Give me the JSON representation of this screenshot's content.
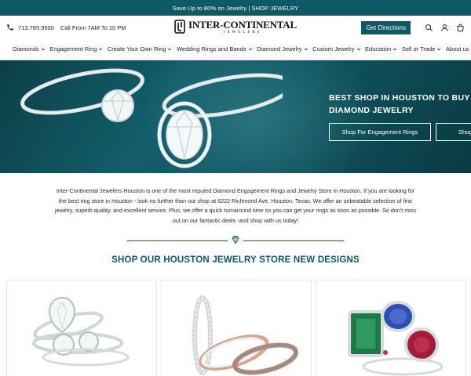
{
  "announcement": "Save Up to 80% on Jewelry | SHOP JEWELRY",
  "header": {
    "phone": "713.785.9500",
    "hours": "Call From 7AM To 10 PM",
    "logo_name": "INTER-CONTINENTAL",
    "logo_sub": "JEWELERS",
    "directions_label": "Get Directions",
    "icons": [
      "search-icon",
      "user-icon",
      "bag-icon"
    ]
  },
  "nav": [
    {
      "label": "Diamonds",
      "dropdown": true
    },
    {
      "label": "Engagement Ring",
      "dropdown": true
    },
    {
      "label": "Create Your Own Ring",
      "dropdown": true
    },
    {
      "label": "Wedding Rings and Bands",
      "dropdown": true
    },
    {
      "label": "Diamond Jewelry",
      "dropdown": true
    },
    {
      "label": "Custom Jewelry",
      "dropdown": true
    },
    {
      "label": "Education",
      "dropdown": true
    },
    {
      "label": "Sell or Trade",
      "dropdown": true
    },
    {
      "label": "About us",
      "dropdown": false
    }
  ],
  "hero": {
    "title_line1": "BEST SHOP IN HOUSTON TO BUY",
    "title_line2": "DIAMOND JEWELRY",
    "button_primary": "Shop For Engagement Rings",
    "button_secondary": "Shop"
  },
  "intro": {
    "text": "Inter-Continental Jewelers Houston is one of the most reputed Diamond Engagement Rings and Jewelry Store in Houston. If you are looking for the best ring store in Houston - look no further than our shop at 6222 Richmond Ave. Houston, Texas. We offer an unbeatable selection of fine jewelry, superb quality, and excellent service. Plus, we offer a quick turnaround time so you can get your rings as soon as possible. So don't miss out on our fantastic deals -and shop with us today!"
  },
  "section_title": "SHOP OUR HOUSTON JEWELRY STORE NEW DESIGNS",
  "colors": {
    "brand_teal": "#0d5a66",
    "hero_dark": "#0c3f47",
    "text": "#1f1f1f"
  }
}
